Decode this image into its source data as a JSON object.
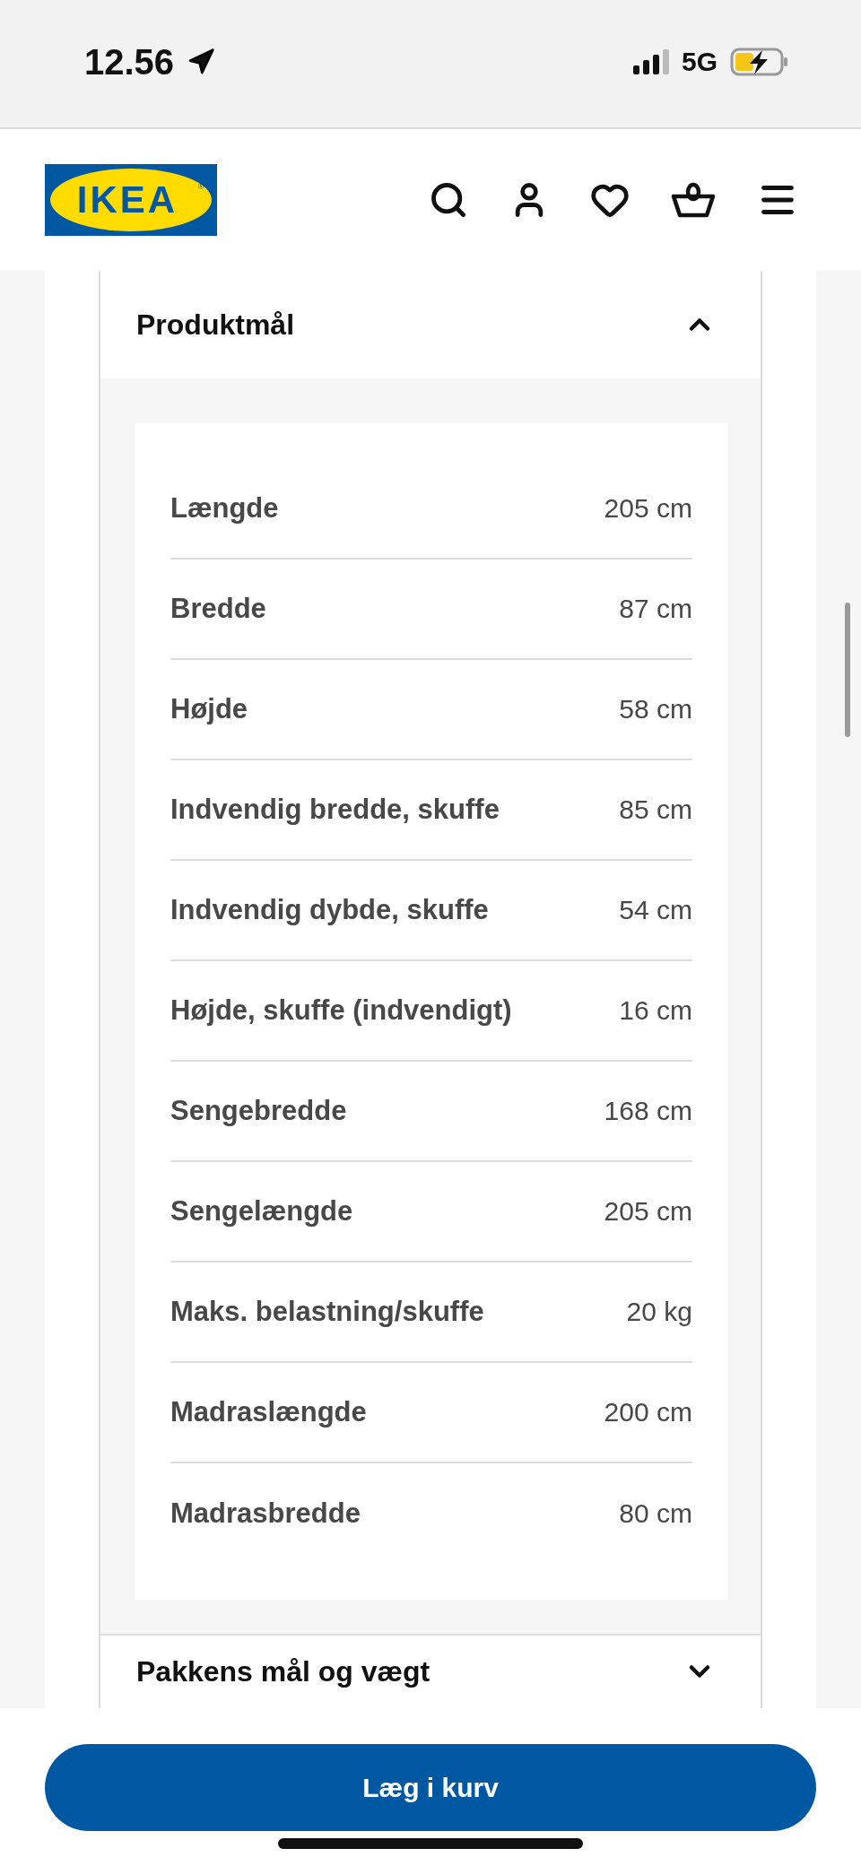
{
  "status_bar": {
    "time": "12.56",
    "network": "5G"
  },
  "header": {
    "logo": {
      "text": "IKEA",
      "mark": "®"
    }
  },
  "sections": [
    {
      "title": "Produktmål",
      "expanded": true,
      "rows": [
        {
          "label": "Længde",
          "value": "205 cm"
        },
        {
          "label": "Bredde",
          "value": "87 cm"
        },
        {
          "label": "Højde",
          "value": "58 cm"
        },
        {
          "label": "Indvendig bredde, skuffe",
          "value": "85 cm"
        },
        {
          "label": "Indvendig dybde, skuffe",
          "value": "54 cm"
        },
        {
          "label": "Højde, skuffe (indvendigt)",
          "value": "16 cm"
        },
        {
          "label": "Sengebredde",
          "value": "168 cm"
        },
        {
          "label": "Sengelængde",
          "value": "205 cm"
        },
        {
          "label": "Maks. belastning/skuffe",
          "value": "20 kg"
        },
        {
          "label": "Madraslængde",
          "value": "200 cm"
        },
        {
          "label": "Madrasbredde",
          "value": "80 cm"
        }
      ]
    },
    {
      "title": "Pakkens mål og vægt",
      "expanded": false
    }
  ],
  "add_to_cart": {
    "label": "Læg i kurv"
  }
}
